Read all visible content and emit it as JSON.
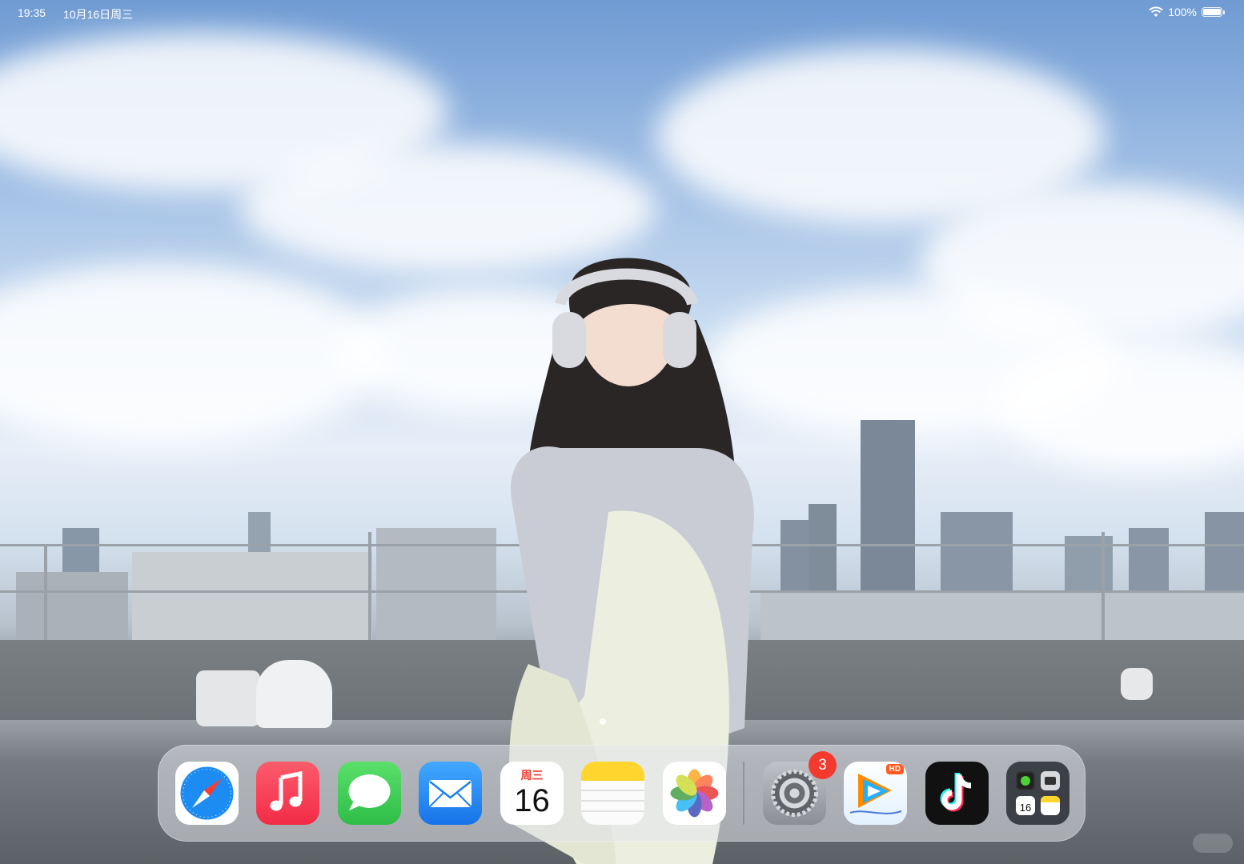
{
  "status_bar": {
    "time": "19:35",
    "date": "10月16日周三",
    "battery_text": "100%",
    "battery_level": 1.0
  },
  "wallpaper": {
    "description_icon": "wallpaper-photo"
  },
  "dock": {
    "apps": [
      {
        "name": "Safari",
        "icon": "safari-icon"
      },
      {
        "name": "Music",
        "icon": "music-icon"
      },
      {
        "name": "Messages",
        "icon": "messages-icon"
      },
      {
        "name": "Mail",
        "icon": "mail-icon"
      },
      {
        "name": "Calendar",
        "icon": "calendar-icon",
        "weekday": "周三",
        "day": "16"
      },
      {
        "name": "Notes",
        "icon": "notes-icon"
      },
      {
        "name": "Photos",
        "icon": "photos-icon"
      },
      {
        "name": "Settings",
        "icon": "settings-icon",
        "badge": "3"
      },
      {
        "name": "Tencent Video",
        "icon": "tencent-video-icon",
        "tag": "HD"
      },
      {
        "name": "TikTok",
        "icon": "tiktok-icon"
      },
      {
        "name": "App Library",
        "icon": "app-library-icon",
        "mini_day": "16"
      }
    ]
  },
  "colors": {
    "safari_blue": "#1d8cf2",
    "music_red": "#f93c4f",
    "messages_green": "#34c759",
    "mail_blue": "#1e88f5",
    "notes_yellow": "#ffd52e",
    "badge_red": "#f23a2f",
    "tiktok_bg": "#111111"
  }
}
